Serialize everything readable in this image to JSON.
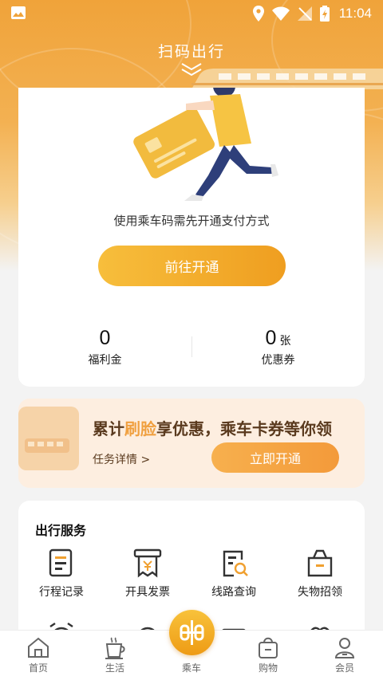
{
  "status_bar": {
    "time": "11:04"
  },
  "header": {
    "title": "扫码出行"
  },
  "pay_card": {
    "tip": "使用乘车码需先开通支付方式",
    "open_button": "前往开通",
    "welfare": {
      "value": "0",
      "label": "福利金"
    },
    "coupons": {
      "value": "0",
      "unit": "张",
      "label": "优惠券"
    }
  },
  "promo": {
    "title_before": "累计",
    "title_highlight": "刷脸",
    "title_after": "享优惠，乘车卡券等你领",
    "link": "任务详情 >",
    "button": "立即开通"
  },
  "services": {
    "title": "出行服务",
    "items": [
      {
        "label": "行程记录",
        "icon": "trip-record-icon"
      },
      {
        "label": "开具发票",
        "icon": "invoice-icon"
      },
      {
        "label": "线路查询",
        "icon": "route-search-icon"
      },
      {
        "label": "失物招领",
        "icon": "lost-found-icon"
      }
    ]
  },
  "tabbar": {
    "items": [
      {
        "label": "首页",
        "icon": "home-icon"
      },
      {
        "label": "生活",
        "icon": "coffee-icon"
      },
      {
        "label": "乘车",
        "icon": "ride-icon"
      },
      {
        "label": "购物",
        "icon": "shopping-bag-icon"
      },
      {
        "label": "会员",
        "icon": "member-icon"
      }
    ]
  },
  "colors": {
    "accent": "#f0a030",
    "promo_bg": "#fdeee0",
    "brown": "#5a3a1e"
  }
}
